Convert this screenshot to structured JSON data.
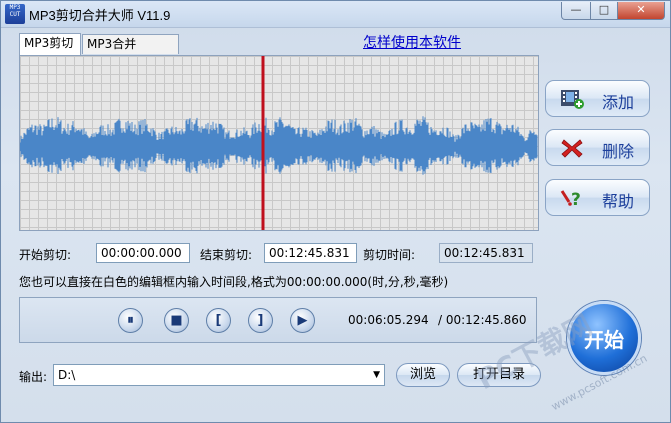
{
  "window": {
    "app_icon_text": "MP3 CUT",
    "title": "MP3剪切合并大师 V11.9",
    "min_glyph": "—",
    "max_glyph": "□",
    "close_glyph": "✕"
  },
  "tabs": [
    {
      "label": "MP3剪切",
      "active": true
    },
    {
      "label": "MP3合并",
      "active": false
    }
  ],
  "help_link": "怎样使用本软件",
  "side_buttons": {
    "add": {
      "label": "添加",
      "icon": "film-add-icon"
    },
    "delete": {
      "label": "删除",
      "icon": "red-x-icon"
    },
    "help": {
      "label": "帮助",
      "icon": "question-icon"
    }
  },
  "waveform": {
    "position_fraction": 0.47,
    "wave_color": "#4a86c8",
    "cursor_color": "#c0101e"
  },
  "cut": {
    "start_label": "开始剪切:",
    "start_value": "00:00:00.000",
    "end_label": "结束剪切:",
    "end_value": "00:12:45.831",
    "duration_label": "剪切时间:",
    "duration_value": "00:12:45.831"
  },
  "hint": "您也可以直接在白色的编辑框内输入时间段,格式为00:00:00.000(时,分,秒,毫秒)",
  "player": {
    "current_time": "00:06:05.294",
    "total_time": "/ 00:12:45.860",
    "buttons": {
      "pause": "⏸",
      "stop": "■",
      "mark_in": "[",
      "mark_out": "]",
      "play": "▶"
    }
  },
  "start_button": "开始",
  "output": {
    "label": "输出:",
    "value": "D:\\",
    "arrow": "▼",
    "browse": "浏览",
    "open_dir": "打开目录"
  },
  "watermark": {
    "main": "PC下载网",
    "url": "www.pcsoft.com.cn"
  }
}
